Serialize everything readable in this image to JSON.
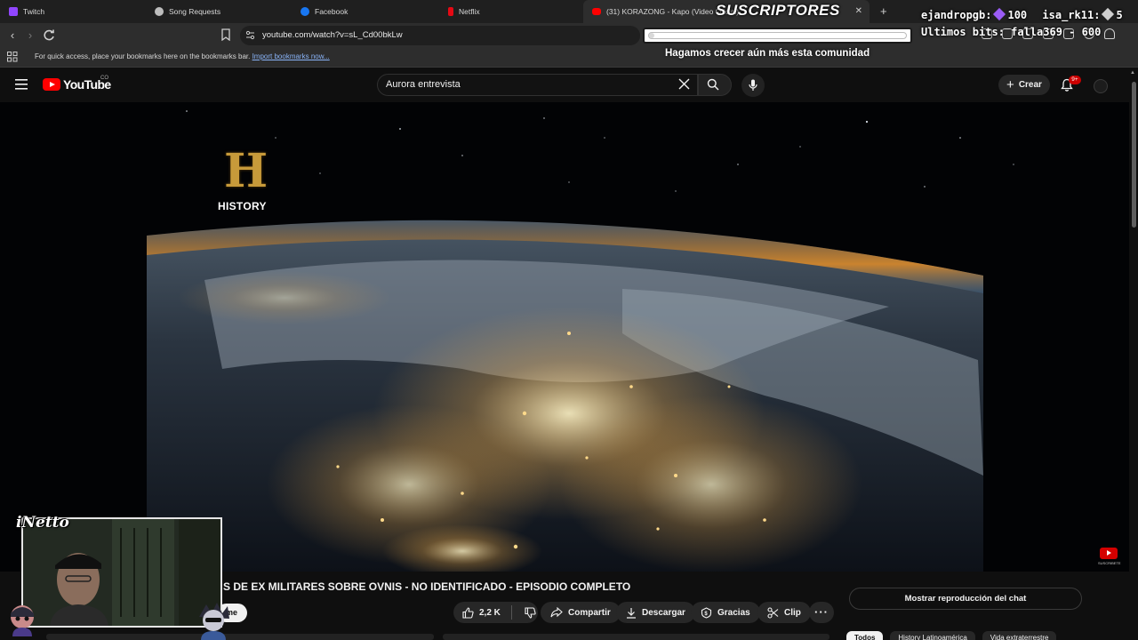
{
  "browser": {
    "tabs": [
      {
        "label": "Twitch",
        "color": "#9146ff"
      },
      {
        "label": "Song Requests",
        "color": "#9e9e9e"
      },
      {
        "label": "Facebook",
        "color": "#1877f2"
      },
      {
        "label": "Netflix",
        "color": "#e50914"
      },
      {
        "label": "(31) KORAZONG - Kapo (Video Oficial)",
        "color": "#ff0000"
      }
    ],
    "url": "youtube.com/watch?v=sL_Cd00bkLw",
    "bookmarks_bar_text": "For quick access, place your bookmarks here on the bookmarks bar.",
    "import_bookmarks_link": "Import bookmarks now..."
  },
  "stream_overlay": {
    "subs_title": "SUSCRIPTORES",
    "community_text": "Hagamos crecer aún más esta comunidad",
    "bits_line1_user": "ejandropgb:",
    "bits_line1_value": "100",
    "bits_line1_user2": "isa_rk11:",
    "bits_line1_value2": "5",
    "bits_line2": "Ultimos bits: falla369 - 600",
    "progress_fraction": 0.02,
    "webcam_name": "iNetto"
  },
  "youtube": {
    "country_code": "CO",
    "search_value": "Aurora entrevista",
    "create_label": "Crear",
    "notification_count": "9+",
    "channel_watermark": "HISTORY",
    "yt_mini_text": "SUSCRIBETE",
    "video_title": "S DE EX MILITARES SOBRE OVNIS - NO IDENTIFICADO - EPISODIO COMPLETO",
    "subscribe_partial": "me",
    "like_count": "2,2 K",
    "share_label": "Compartir",
    "download_label": "Descargar",
    "thanks_label": "Gracias",
    "clip_label": "Clip",
    "chat_replay_label": "Mostrar reproducción del chat",
    "chips": [
      "Todos",
      "History Latinoamérica",
      "Vida extraterrestre"
    ]
  },
  "colors": {
    "youtube_red": "#ff0000",
    "history_gold": "#c79a3a",
    "background": "#0f0f0f"
  }
}
